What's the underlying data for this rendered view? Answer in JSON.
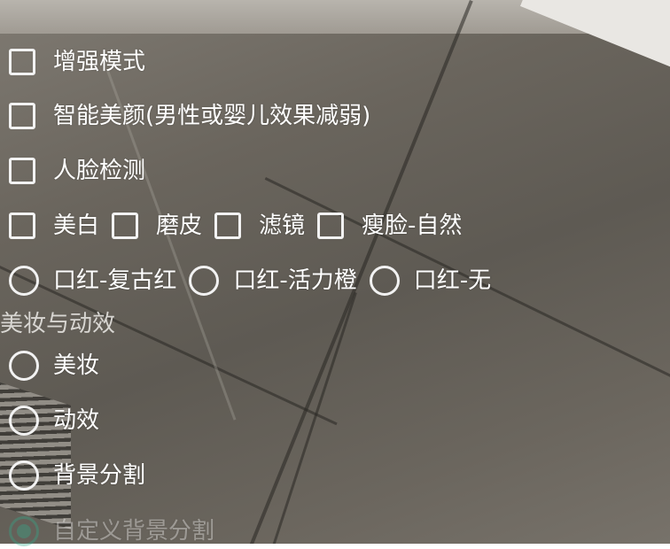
{
  "options": {
    "enhance_mode": "增强模式",
    "smart_beauty": "智能美颜(男性或婴儿效果减弱)",
    "face_detect": "人脸检测",
    "whiten": "美白",
    "smooth": "磨皮",
    "filter": "滤镜",
    "slim_face": "瘦脸-自然",
    "lipstick_retro": "口红-复古红",
    "lipstick_vital": "口红-活力橙",
    "lipstick_none": "口红-无"
  },
  "section": {
    "title": "美妆与动效"
  },
  "effects": {
    "makeup": "美妆",
    "animation": "动效",
    "bg_segment": "背景分割",
    "custom_bg_segment": "自定义背景分割"
  },
  "colors": {
    "text": "#ffffff",
    "accent": "#2fae8e"
  }
}
